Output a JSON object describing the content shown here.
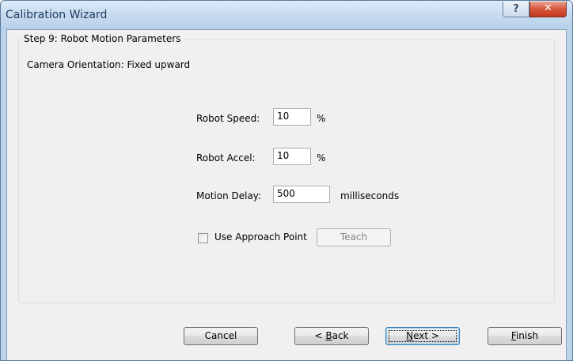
{
  "window": {
    "title": "Calibration Wizard",
    "help_glyph": "?",
    "close_glyph": "✕"
  },
  "step": {
    "legend": "Step 9: Robot Motion Parameters",
    "camera_orientation": "Camera Orientation: Fixed upward"
  },
  "fields": {
    "robot_speed": {
      "label": "Robot Speed:",
      "value": "10",
      "unit": "%"
    },
    "robot_accel": {
      "label": "Robot Accel:",
      "value": "10",
      "unit": "%"
    },
    "motion_delay": {
      "label": "Motion Delay:",
      "value": "500",
      "unit": "milliseconds"
    }
  },
  "approach": {
    "checkbox_label": "Use Approach Point",
    "checked": false,
    "teach_label": "Teach"
  },
  "buttons": {
    "cancel": {
      "label": "Cancel"
    },
    "back": {
      "prefix": "< ",
      "mnemonic": "B",
      "rest": "ack"
    },
    "next": {
      "mnemonic": "N",
      "rest": "ext >"
    },
    "finish": {
      "mnemonic": "F",
      "rest": "inish"
    }
  }
}
